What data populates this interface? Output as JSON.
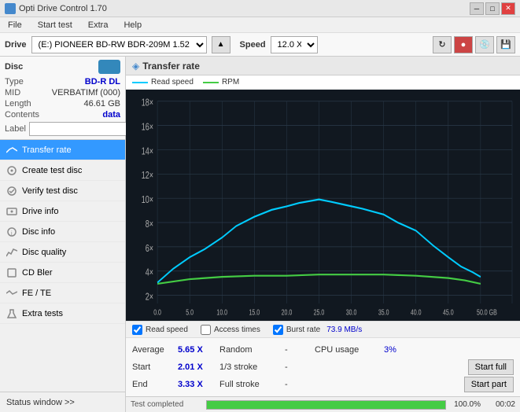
{
  "titlebar": {
    "icon": "⊙",
    "title": "Opti Drive Control 1.70",
    "btn_min": "─",
    "btn_max": "□",
    "btn_close": "✕"
  },
  "menubar": {
    "items": [
      "File",
      "Start test",
      "Extra",
      "Help"
    ]
  },
  "drivebar": {
    "drive_label": "Drive",
    "drive_value": "(E:)  PIONEER BD-RW   BDR-209M 1.52",
    "speed_label": "Speed",
    "speed_value": "12.0 X ↓"
  },
  "disc": {
    "title": "Disc",
    "type_label": "Type",
    "type_val": "BD-R DL",
    "mid_label": "MID",
    "mid_val": "VERBATIMf (000)",
    "length_label": "Length",
    "length_val": "46.61 GB",
    "contents_label": "Contents",
    "contents_val": "data",
    "label_label": "Label",
    "label_val": ""
  },
  "nav": {
    "items": [
      {
        "id": "transfer-rate",
        "text": "Transfer rate",
        "active": true
      },
      {
        "id": "create-test-disc",
        "text": "Create test disc",
        "active": false
      },
      {
        "id": "verify-test-disc",
        "text": "Verify test disc",
        "active": false
      },
      {
        "id": "drive-info",
        "text": "Drive info",
        "active": false
      },
      {
        "id": "disc-info",
        "text": "Disc info",
        "active": false
      },
      {
        "id": "disc-quality",
        "text": "Disc quality",
        "active": false
      },
      {
        "id": "cd-bler",
        "text": "CD Bler",
        "active": false
      },
      {
        "id": "fe-te",
        "text": "FE / TE",
        "active": false
      },
      {
        "id": "extra-tests",
        "text": "Extra tests",
        "active": false
      }
    ],
    "status_window": "Status window >>"
  },
  "chart": {
    "title": "Transfer rate",
    "legend": [
      {
        "color": "#00ccff",
        "label": "Read speed"
      },
      {
        "color": "#44cc44",
        "label": "RPM"
      }
    ],
    "y_labels": [
      "18×",
      "16×",
      "14×",
      "12×",
      "10×",
      "8×",
      "6×",
      "4×",
      "2×"
    ],
    "x_labels": [
      "0.0",
      "5.0",
      "10.0",
      "15.0",
      "20.0",
      "25.0",
      "30.0",
      "35.0",
      "40.0",
      "45.0",
      "50.0 GB"
    ]
  },
  "controls": {
    "read_speed_checked": true,
    "read_speed_label": "Read speed",
    "access_times_checked": false,
    "access_times_label": "Access times",
    "burst_rate_checked": true,
    "burst_rate_label": "Burst rate",
    "burst_val": "73.9 MB/s"
  },
  "stats": {
    "average_label": "Average",
    "average_val": "5.65 X",
    "random_label": "Random",
    "random_val": "-",
    "cpu_usage_label": "CPU usage",
    "cpu_usage_val": "3%",
    "start_label": "Start",
    "start_val": "2.01 X",
    "stroke_1_3_label": "1/3 stroke",
    "stroke_1_3_val": "-",
    "start_full_label": "Start full",
    "end_label": "End",
    "end_val": "3.33 X",
    "full_stroke_label": "Full stroke",
    "full_stroke_val": "-",
    "start_part_label": "Start part"
  },
  "progress": {
    "label": "Test completed",
    "percent": "100.0%",
    "fill_width": "100%",
    "time": "00:02"
  }
}
